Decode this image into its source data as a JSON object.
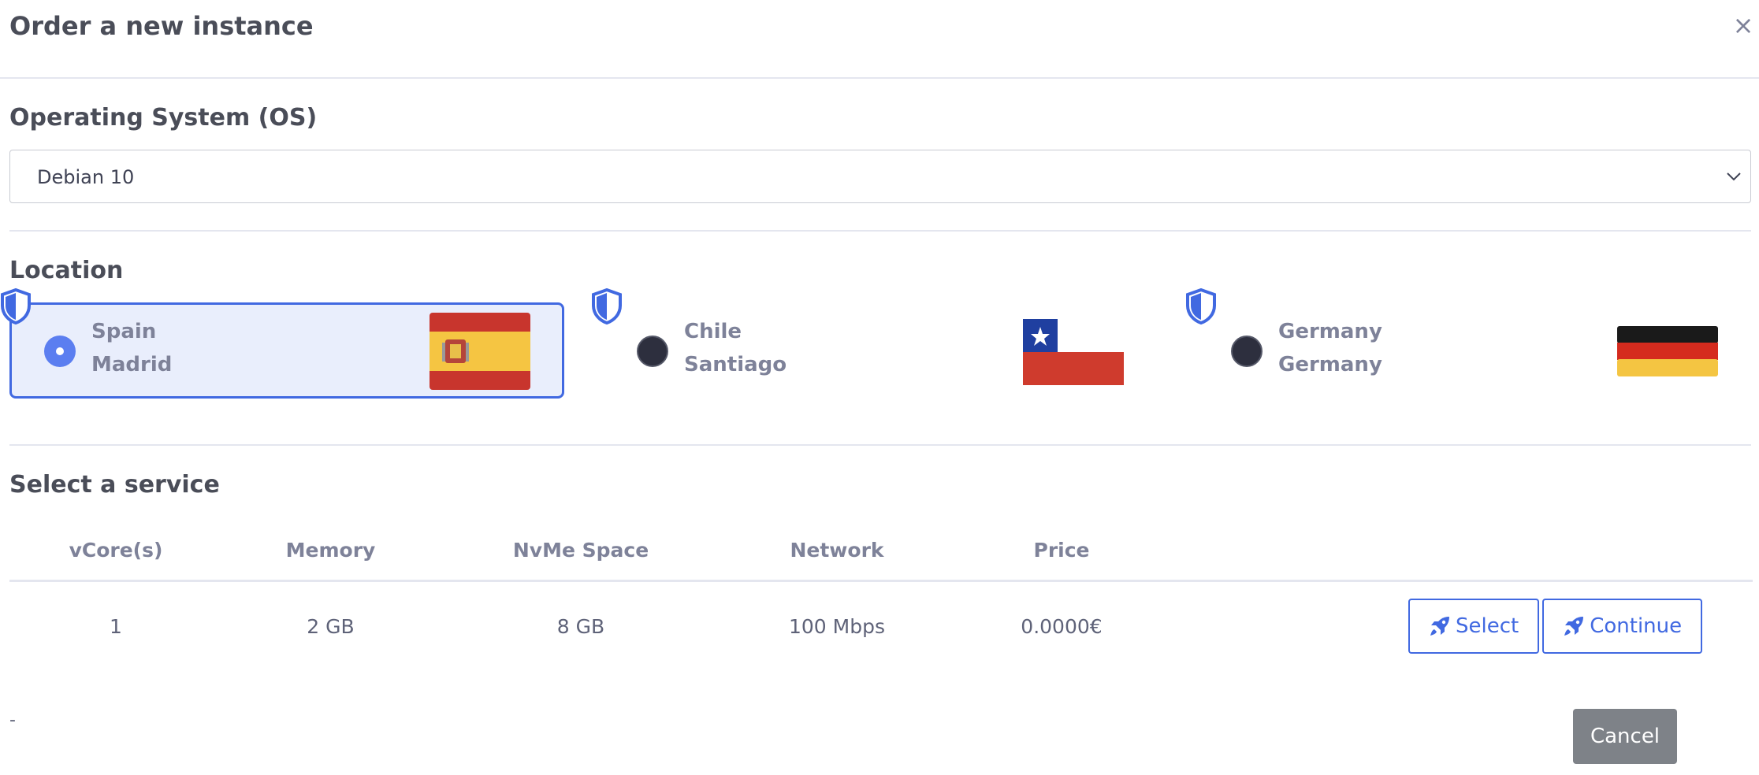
{
  "modal": {
    "title": "Order a new instance",
    "close_label": "×"
  },
  "os": {
    "section_title": "Operating System (OS)",
    "selected": "Debian 10"
  },
  "location": {
    "section_title": "Location",
    "options": [
      {
        "country": "Spain",
        "city": "Madrid",
        "selected": true,
        "flag_icon": "spain-flag-icon"
      },
      {
        "country": "Chile",
        "city": "Santiago",
        "selected": false,
        "flag_icon": "chile-flag-icon"
      },
      {
        "country": "Germany",
        "city": "Germany",
        "selected": false,
        "flag_icon": "germany-flag-icon"
      }
    ]
  },
  "service": {
    "section_title": "Select a service",
    "columns": [
      "vCore(s)",
      "Memory",
      "NvMe Space",
      "Network",
      "Price"
    ],
    "rows": [
      {
        "vcores": "1",
        "memory": "2 GB",
        "space": "8 GB",
        "network": "100 Mbps",
        "price": "0.0000€"
      }
    ],
    "select_label": "Select",
    "continue_label": "Continue"
  },
  "footer": {
    "dash": "-",
    "cancel_label": "Cancel"
  },
  "colors": {
    "accent": "#4169e1",
    "selected_bg": "#e9eefc",
    "cancel_bg": "#7e8288"
  }
}
